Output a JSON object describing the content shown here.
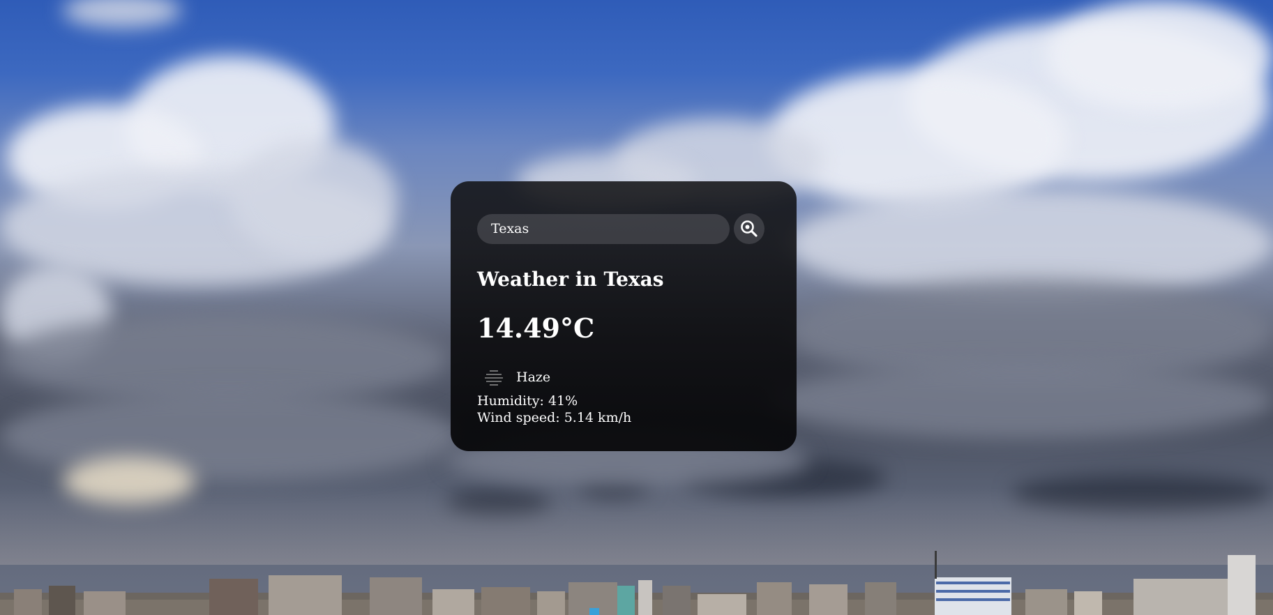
{
  "search": {
    "value": "Texas",
    "icon": "magnifier-search-icon"
  },
  "weather": {
    "title": "Weather in Texas",
    "temperature": "14.49°C",
    "description": "Haze",
    "description_icon": "haze-icon",
    "humidity": "Humidity: 41%",
    "wind": "Wind speed: 5.14 km/h"
  },
  "colors": {
    "card_background": "#0c0c0e",
    "text": "#ffffff",
    "input_background": "#7d7d82",
    "sky_top": "#2f5cb8"
  }
}
